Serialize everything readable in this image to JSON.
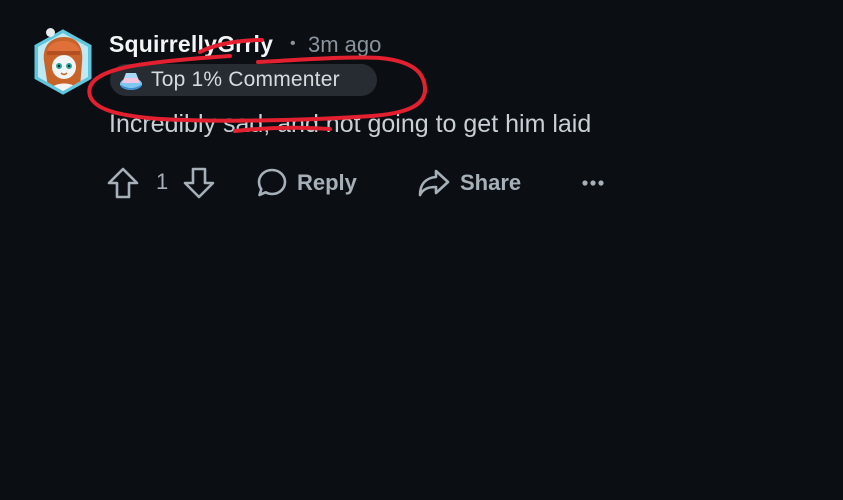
{
  "comment": {
    "username": "SquirrellyGrrly",
    "separator": "•",
    "timestamp": "3m ago",
    "flair": {
      "icon": "commenter-badge-icon",
      "label": "Top 1% Commenter"
    },
    "body": "Incredibly sad, and not going to get him laid"
  },
  "actions": {
    "vote_count": "1",
    "reply_label": "Reply",
    "share_label": "Share",
    "more_icon": "more-options-icon"
  },
  "colors": {
    "background": "#0b0f13",
    "annotation_red": "#e3202f",
    "flair_bg": "#262c31"
  }
}
